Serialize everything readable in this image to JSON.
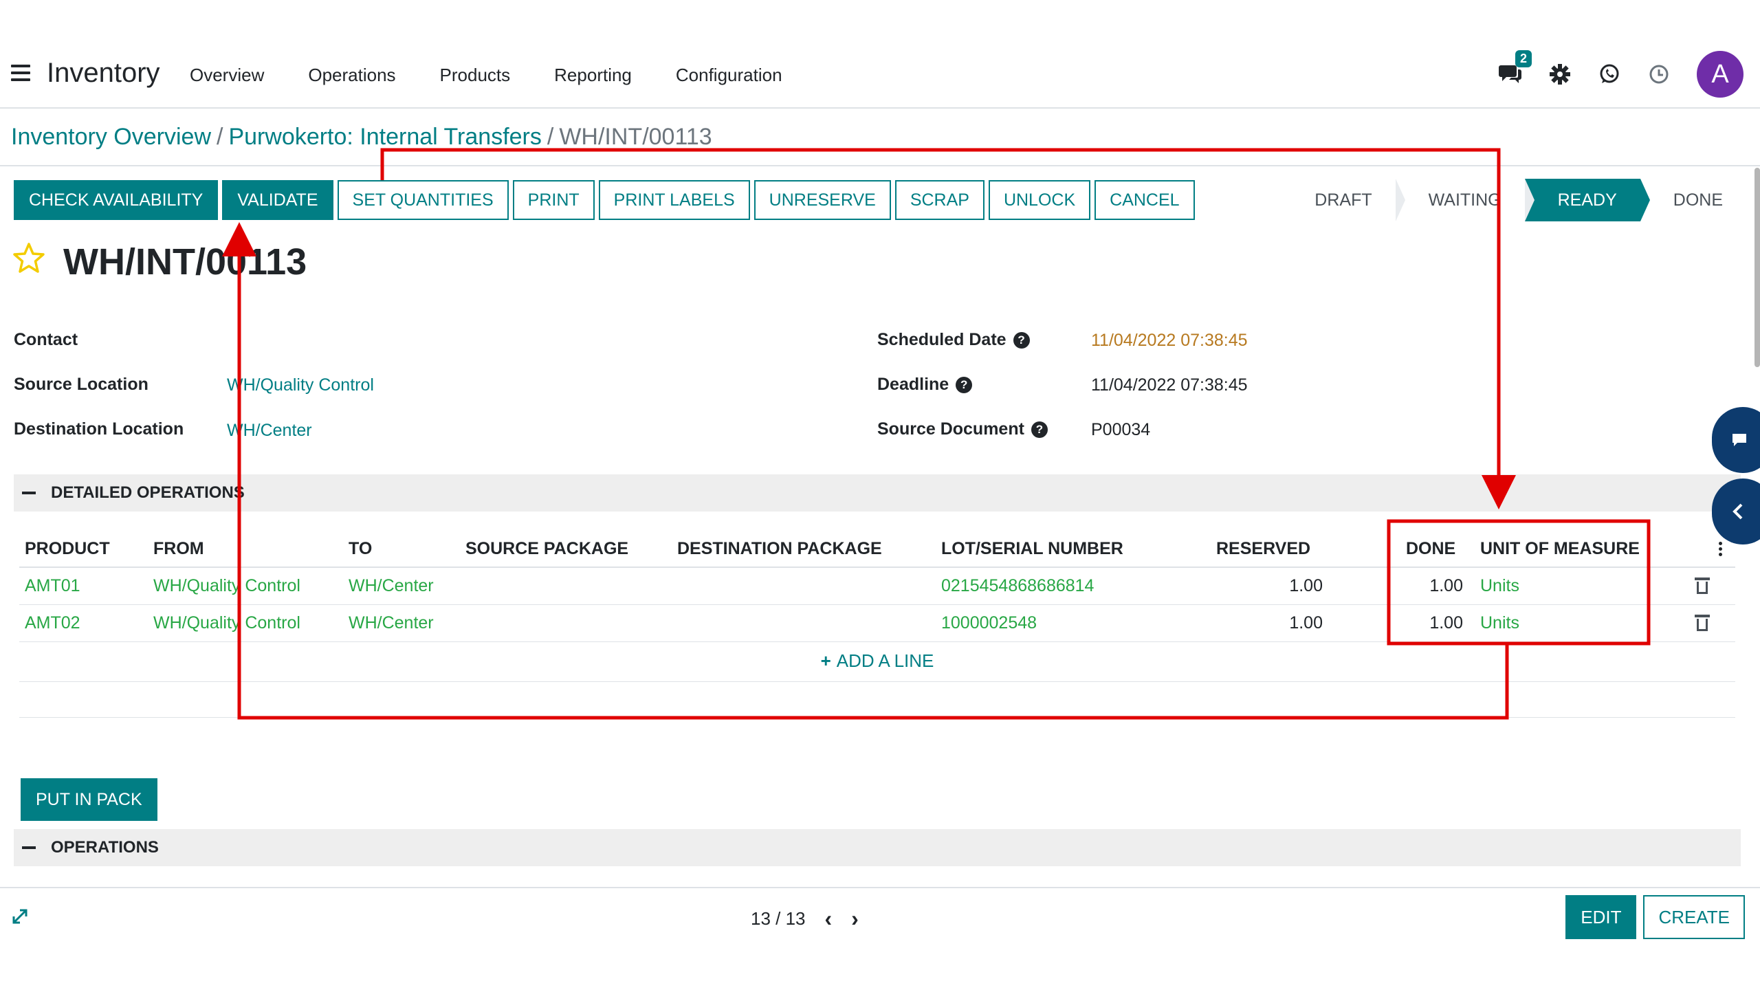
{
  "app": {
    "name": "Inventory"
  },
  "nav": [
    "Overview",
    "Operations",
    "Products",
    "Reporting",
    "Configuration"
  ],
  "systray": {
    "messages_count": "2",
    "avatar_letter": "A"
  },
  "breadcrumb": {
    "items": [
      "Inventory Overview",
      "Purwokerto: Internal Transfers"
    ],
    "separator": "/",
    "current": "WH/INT/00113"
  },
  "actions": {
    "primary": [
      "CHECK AVAILABILITY",
      "VALIDATE"
    ],
    "secondary": [
      "SET QUANTITIES",
      "PRINT",
      "PRINT LABELS",
      "UNRESERVE",
      "SCRAP",
      "UNLOCK",
      "CANCEL"
    ]
  },
  "stages": {
    "items": [
      "DRAFT",
      "WAITING",
      "READY",
      "DONE"
    ],
    "active": "READY"
  },
  "record": {
    "title": "WH/INT/00113"
  },
  "fields": {
    "contact_label": "Contact",
    "source_location_label": "Source Location",
    "source_location_value": "WH/Quality Control",
    "destination_location_label": "Destination Location",
    "destination_location_value": "WH/Center",
    "scheduled_date_label": "Scheduled Date",
    "scheduled_date_value": "11/04/2022 07:38:45",
    "deadline_label": "Deadline",
    "deadline_value": "11/04/2022 07:38:45",
    "source_document_label": "Source Document",
    "source_document_value": "P00034",
    "help_glyph": "?"
  },
  "detailed_operations": {
    "title": "DETAILED OPERATIONS",
    "columns": [
      "PRODUCT",
      "FROM",
      "TO",
      "SOURCE PACKAGE",
      "DESTINATION PACKAGE",
      "LOT/SERIAL NUMBER",
      "RESERVED",
      "DONE",
      "UNIT OF MEASURE"
    ],
    "rows": [
      {
        "product": "AMT01",
        "from": "WH/Quality Control",
        "to": "WH/Center",
        "lot": "0215454868686814",
        "reserved": "1.00",
        "done": "1.00",
        "uom": "Units"
      },
      {
        "product": "AMT02",
        "from": "WH/Quality Control",
        "to": "WH/Center",
        "lot": "1000002548",
        "reserved": "1.00",
        "done": "1.00",
        "uom": "Units"
      }
    ],
    "add_line": "ADD A LINE",
    "add_line_plus": "+"
  },
  "put_in_pack": "PUT IN PACK",
  "operations_section": {
    "title": "OPERATIONS"
  },
  "pager": {
    "value": "13 / 13",
    "prev": "‹",
    "next": "›"
  },
  "footer": {
    "edit": "EDIT",
    "create": "CREATE"
  },
  "colors": {
    "primary": "#017e84",
    "annotation": "#e00000",
    "avatar": "#6f2da8",
    "star": "#f3cc00"
  },
  "icons": [
    "hamburger-icon",
    "chat-icon",
    "gear-icon",
    "whatsapp-icon",
    "clock-icon",
    "star-icon",
    "help-icon",
    "trash-icon",
    "kebab-icon",
    "expand-icon",
    "chevron-left-icon",
    "chevron-right-icon"
  ]
}
